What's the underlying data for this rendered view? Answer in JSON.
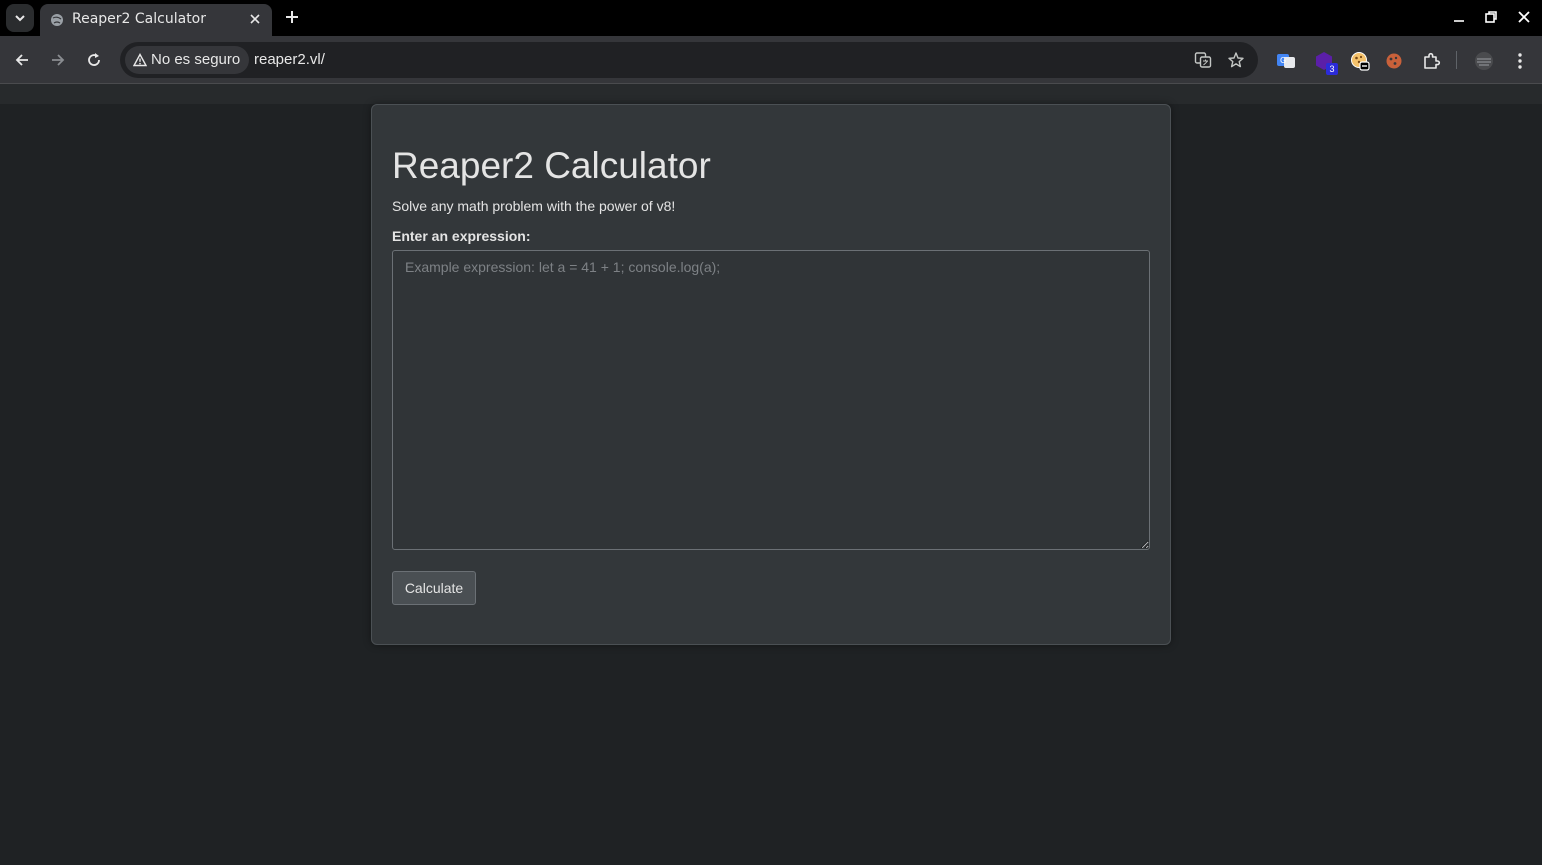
{
  "browser": {
    "tab_title": "Reaper2 Calculator",
    "security_label": "No es seguro",
    "url": "reaper2.vl/",
    "extension_badge": "3"
  },
  "page": {
    "title": "Reaper2 Calculator",
    "subtitle": "Solve any math problem with the power of v8!",
    "expression_label": "Enter an expression:",
    "expression_value": "",
    "expression_placeholder": "Example expression: let a = 41 + 1; console.log(a);",
    "calculate_label": "Calculate"
  },
  "colors": {
    "page_background": "#1f2224",
    "card_background": "#33373a",
    "chrome_tabbar": "#000000",
    "chrome_toolbar": "#35363a"
  }
}
